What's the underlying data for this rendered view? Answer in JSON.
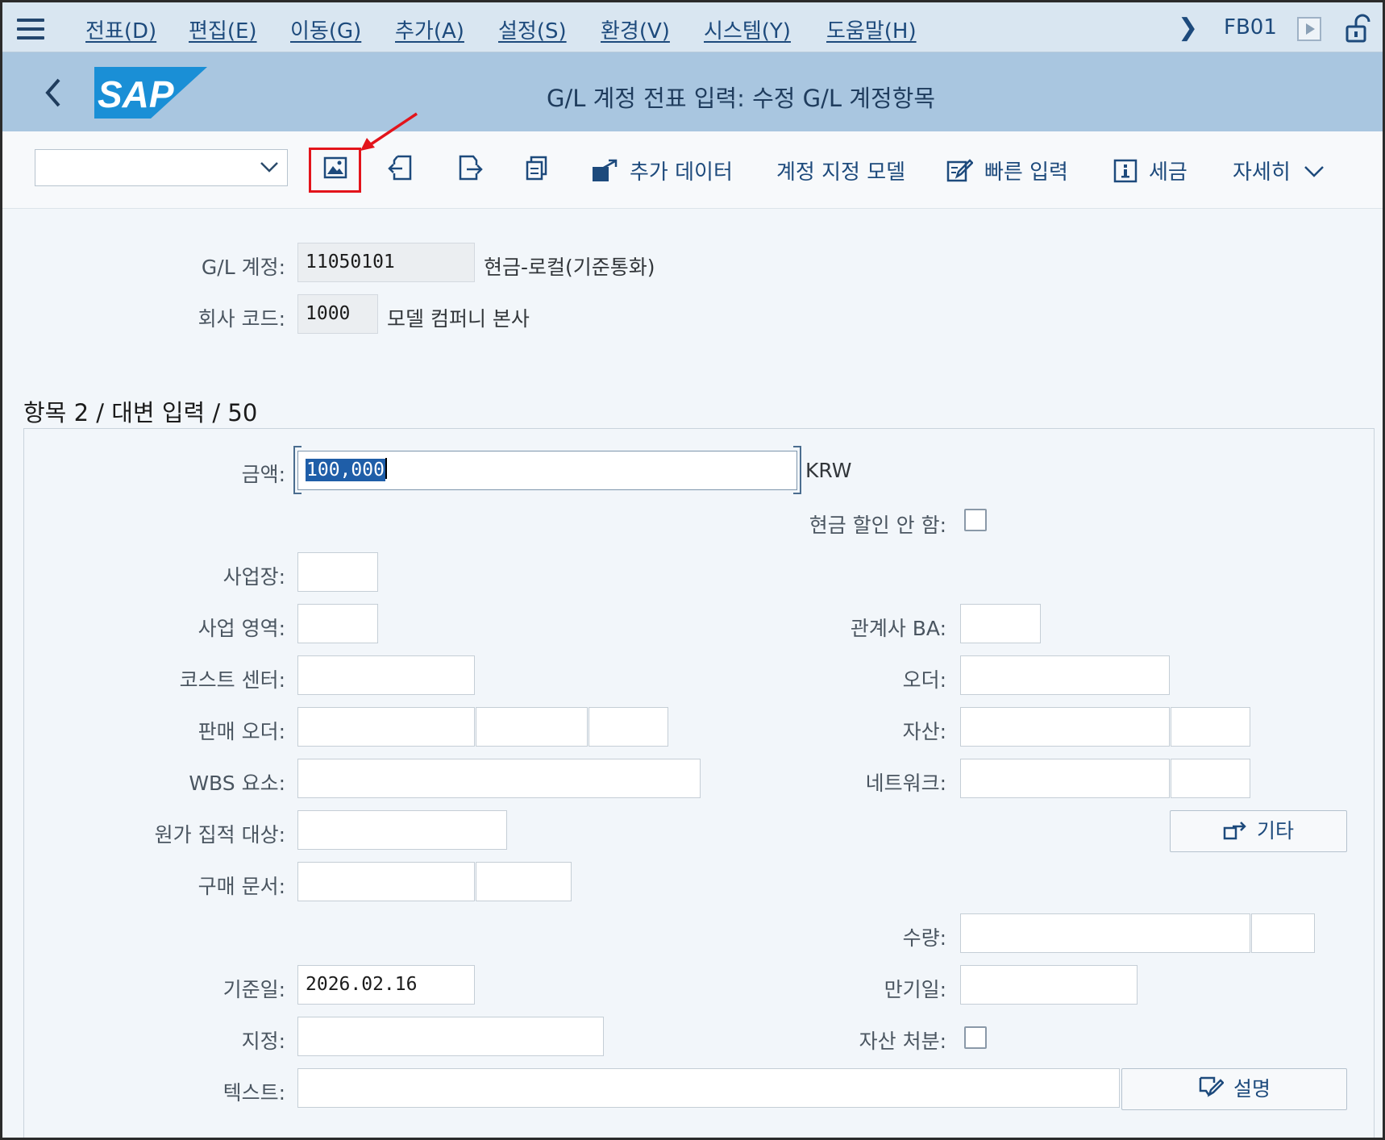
{
  "menubar": {
    "items": [
      "전표(D)",
      "편집(E)",
      "이동(G)",
      "추가(A)",
      "설정(S)",
      "환경(V)",
      "시스템(Y)",
      "도움말(H)"
    ],
    "tcode": "FB01"
  },
  "titlebar": {
    "logo_text": "SAP",
    "title": "G/L 계정 전표 입력: 수정 G/L 계정항목"
  },
  "toolbar": {
    "select_value": "",
    "additional_data": "추가 데이터",
    "account_model": "계정 지정 모델",
    "fast_entry": "빠른 입력",
    "tax": "세금",
    "more": "자세히"
  },
  "header": {
    "gl_account_label": "G/L 계정:",
    "gl_account_value": "11050101",
    "gl_account_desc": "현금-로컬(기준통화)",
    "company_code_label": "회사 코드:",
    "company_code_value": "1000",
    "company_code_desc": "모델 컴퍼니 본사"
  },
  "section": {
    "title": "항목 2 / 대변 입력 / 50"
  },
  "form": {
    "amount_label": "금액:",
    "amount_value": "100,000",
    "currency": "KRW",
    "no_cash_discount_label": "현금 할인 안 함:",
    "business_place_label": "사업장:",
    "business_area_label": "사업 영역:",
    "trading_partner_ba_label": "관계사 BA:",
    "cost_center_label": "코스트 센터:",
    "order_label": "오더:",
    "sales_order_label": "판매 오더:",
    "asset_label": "자산:",
    "wbs_label": "WBS 요소:",
    "network_label": "네트워크:",
    "cost_object_label": "원가 집적 대상:",
    "more_button": "기타",
    "purchasing_doc_label": "구매 문서:",
    "quantity_label": "수량:",
    "baseline_date_label": "기준일:",
    "baseline_date_value": "2026.02.16",
    "due_date_label": "만기일:",
    "assignment_label": "지정:",
    "asset_retirement_label": "자산 처분:",
    "text_label": "텍스트:",
    "long_text_button": "설명"
  },
  "colors": {
    "menubar_bg": "#d9e6f1",
    "titlebar_bg": "#a9c6e0",
    "link_blue": "#1d4a7c",
    "highlight_red": "#e3141b",
    "sap_logo_blue": "#1a8fd6"
  }
}
